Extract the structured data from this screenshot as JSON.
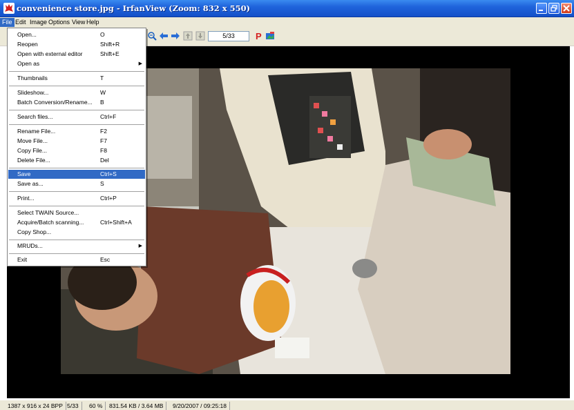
{
  "window": {
    "title": "convenience store.jpg - IrfanView (Zoom: 832 x 550)",
    "title_color": "#1f64dc",
    "app_icon": "irfanview-red-cat-icon",
    "controls": [
      "minimize-icon",
      "restore-icon",
      "close-icon"
    ]
  },
  "menubar": {
    "items": [
      {
        "label": "File",
        "active": true
      },
      {
        "label": "Edit"
      },
      {
        "label": "Image"
      },
      {
        "label": "Options"
      },
      {
        "label": "View"
      },
      {
        "label": "Help"
      }
    ],
    "highlight_color": "#316ac5"
  },
  "toolbar": {
    "icons": [
      "zoom-out-icon",
      "previous-icon",
      "next-icon",
      "first-file-icon",
      "last-file-icon",
      "paint-icon",
      "irfanview-icon"
    ],
    "page_counter": "5/33"
  },
  "file_menu": {
    "items": [
      {
        "label": "Open...",
        "shortcut": "O"
      },
      {
        "label": "Reopen",
        "shortcut": "Shift+R"
      },
      {
        "label": "Open with external editor",
        "shortcut": "Shift+E"
      },
      {
        "label": "Open as",
        "shortcut": "",
        "submenu": true
      },
      {
        "label": "Thumbnails",
        "shortcut": "T"
      },
      {
        "label": "Slideshow...",
        "shortcut": "W"
      },
      {
        "label": "Batch Conversion/Rename...",
        "shortcut": "B"
      },
      {
        "label": "Search files...",
        "shortcut": "Ctrl+F"
      },
      {
        "label": "Rename File...",
        "shortcut": "F2"
      },
      {
        "label": "Move File...",
        "shortcut": "F7"
      },
      {
        "label": "Copy File...",
        "shortcut": "F8"
      },
      {
        "label": "Delete File...",
        "shortcut": "Del"
      },
      {
        "label": "Save",
        "shortcut": "Ctrl+S",
        "highlighted": true
      },
      {
        "label": "Save as...",
        "shortcut": "S"
      },
      {
        "label": "Print...",
        "shortcut": "Ctrl+P"
      },
      {
        "label": "Select TWAIN Source...",
        "shortcut": ""
      },
      {
        "label": "Acquire/Batch scanning...",
        "shortcut": "Ctrl+Shift+A"
      },
      {
        "label": "Copy Shop...",
        "shortcut": ""
      },
      {
        "label": "MRUDs...",
        "shortcut": "",
        "submenu": true
      },
      {
        "label": "Exit",
        "shortcut": "Esc"
      }
    ]
  },
  "statusbar": {
    "dimensions": "1387 x 916 x 24 BPP",
    "index": "5/33",
    "zoom": "60 %",
    "size": "831.54 KB / 3.64 MB",
    "datetime": "9/20/2007 / 09:25:18"
  }
}
